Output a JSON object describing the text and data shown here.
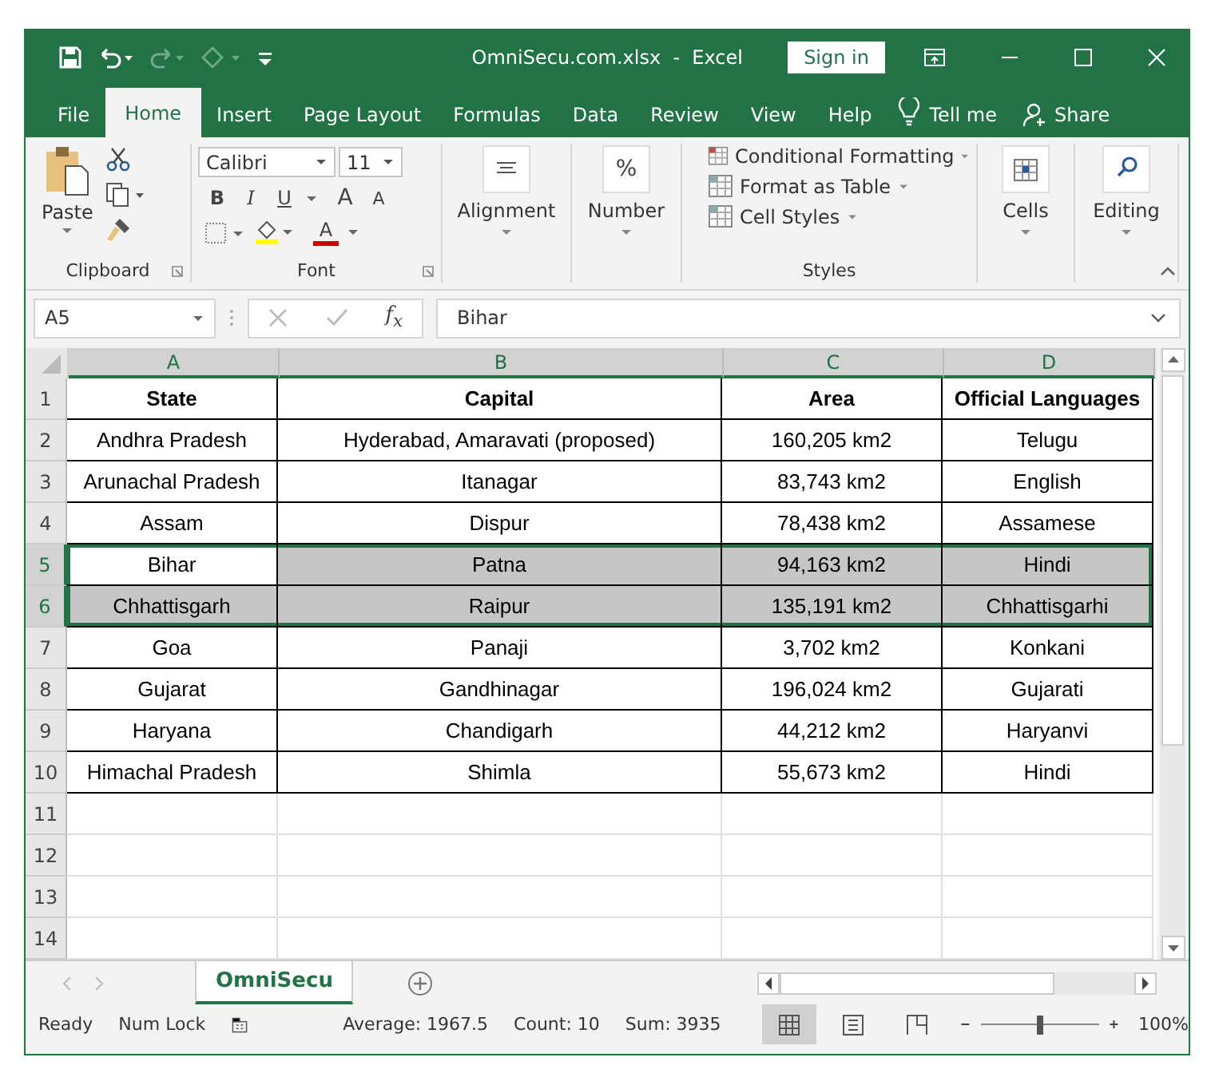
{
  "window": {
    "title": "OmniSecu.com.xlsx  -  Excel",
    "sign_in": "Sign in"
  },
  "ribbon_tabs": [
    {
      "label": "File",
      "selected": false
    },
    {
      "label": "Home",
      "selected": true
    },
    {
      "label": "Insert",
      "selected": false
    },
    {
      "label": "Page Layout",
      "selected": false
    },
    {
      "label": "Formulas",
      "selected": false
    },
    {
      "label": "Data",
      "selected": false
    },
    {
      "label": "Review",
      "selected": false
    },
    {
      "label": "View",
      "selected": false
    },
    {
      "label": "Help",
      "selected": false
    }
  ],
  "tell_me": "Tell me",
  "share": "Share",
  "ribbon": {
    "clipboard": {
      "paste": "Paste",
      "label": "Clipboard"
    },
    "font": {
      "name": "Calibri",
      "size": "11",
      "bold": "B",
      "italic": "I",
      "underline": "U",
      "grow": "A",
      "shrink": "A",
      "font_color": "A",
      "label": "Font"
    },
    "alignment": "Alignment",
    "number": {
      "symbol": "%",
      "label": "Number"
    },
    "styles": {
      "items": [
        "Conditional Formatting",
        "Format as Table",
        "Cell Styles"
      ],
      "label": "Styles"
    },
    "cells": "Cells",
    "editing": "Editing"
  },
  "name_box": "A5",
  "function_icon": "f$_{x}$",
  "formula": "Bihar",
  "sheet": {
    "columns": [
      {
        "label": "A",
        "selected": true
      },
      {
        "label": "B",
        "selected": true
      },
      {
        "label": "C",
        "selected": true
      },
      {
        "label": "D",
        "selected": true
      }
    ],
    "rows": [
      {
        "number": "1",
        "kind": "header",
        "selected": false,
        "cells": [
          "State",
          "Capital",
          "Area",
          "Official Languages"
        ]
      },
      {
        "number": "2",
        "kind": "data",
        "selected": false,
        "cells": [
          "Andhra Pradesh",
          "Hyderabad, Amaravati (proposed)",
          "160,205 km2",
          "Telugu"
        ]
      },
      {
        "number": "3",
        "kind": "data",
        "selected": false,
        "cells": [
          "Arunachal Pradesh",
          "Itanagar",
          "83,743 km2",
          "English"
        ]
      },
      {
        "number": "4",
        "kind": "data",
        "selected": false,
        "cells": [
          "Assam",
          "Dispur",
          "78,438 km2",
          "Assamese"
        ]
      },
      {
        "number": "5",
        "kind": "data",
        "selected": true,
        "active": true,
        "cells": [
          "Bihar",
          "Patna",
          "94,163 km2",
          "Hindi"
        ]
      },
      {
        "number": "6",
        "kind": "data",
        "selected": true,
        "cells": [
          "Chhattisgarh",
          "Raipur",
          "135,191 km2",
          "Chhattisgarhi"
        ]
      },
      {
        "number": "7",
        "kind": "data",
        "selected": false,
        "cells": [
          "Goa",
          "Panaji",
          "3,702 km2",
          "Konkani"
        ]
      },
      {
        "number": "8",
        "kind": "data",
        "selected": false,
        "cells": [
          "Gujarat",
          "Gandhinagar",
          "196,024 km2",
          "Gujarati"
        ]
      },
      {
        "number": "9",
        "kind": "data",
        "selected": false,
        "cells": [
          "Haryana",
          "Chandigarh",
          "44,212 km2",
          "Haryanvi"
        ]
      },
      {
        "number": "10",
        "kind": "data",
        "selected": false,
        "cells": [
          "Himachal Pradesh",
          "Shimla",
          "55,673 km2",
          "Hindi"
        ]
      },
      {
        "number": "11",
        "kind": "empty",
        "selected": false
      },
      {
        "number": "12",
        "kind": "empty",
        "selected": false
      },
      {
        "number": "13",
        "kind": "empty",
        "selected": false
      },
      {
        "number": "14",
        "kind": "empty",
        "selected": false
      }
    ]
  },
  "sheet_tabs": [
    {
      "label": "OmniSecu",
      "selected": true
    }
  ],
  "status": {
    "ready": "Ready",
    "num_lock": "Num Lock",
    "average": "Average: 1967.5",
    "count": "Count: 10",
    "sum": "Sum: 3935",
    "views": [
      {
        "kind": "normal",
        "selected": true
      },
      {
        "kind": "page_layout",
        "selected": false
      },
      {
        "kind": "page_break",
        "selected": false
      }
    ],
    "zoom": {
      "level": 0.5,
      "reading": "100%"
    }
  }
}
